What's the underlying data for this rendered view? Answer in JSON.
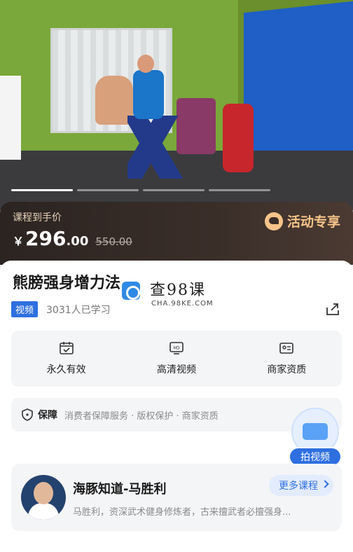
{
  "video": {
    "carousel_count": 4,
    "active_index": 0
  },
  "price": {
    "label": "课程到手价",
    "currency": "￥",
    "integer": "296",
    "decimal": ".00",
    "original": "550.00",
    "promo_label": "活动专享"
  },
  "course": {
    "title": "熊膀强身增力法",
    "type_tag": "视频",
    "learners": "3031人已学习"
  },
  "watermark": {
    "text": "查98课",
    "sub": "CHA.98KE.COM"
  },
  "features": [
    {
      "label": "永久有效",
      "icon": "calendar-check-icon"
    },
    {
      "label": "高清视频",
      "icon": "hd-monitor-icon"
    },
    {
      "label": "商家资质",
      "icon": "id-card-icon"
    }
  ],
  "guarantee": {
    "title": "保障",
    "items": "消费者保障服务 · 版权保护 · 商家资质"
  },
  "float_button": {
    "label": "拍视频"
  },
  "teacher": {
    "name": "海豚知道-马胜利",
    "description": "马胜利，资深武术健身修炼者，古来擅武者必擅强身...",
    "more_label": "更多课程"
  },
  "colors": {
    "accent": "#2e6fe0",
    "promo": "#f6c48a",
    "price_bar": "#3a2e29"
  }
}
